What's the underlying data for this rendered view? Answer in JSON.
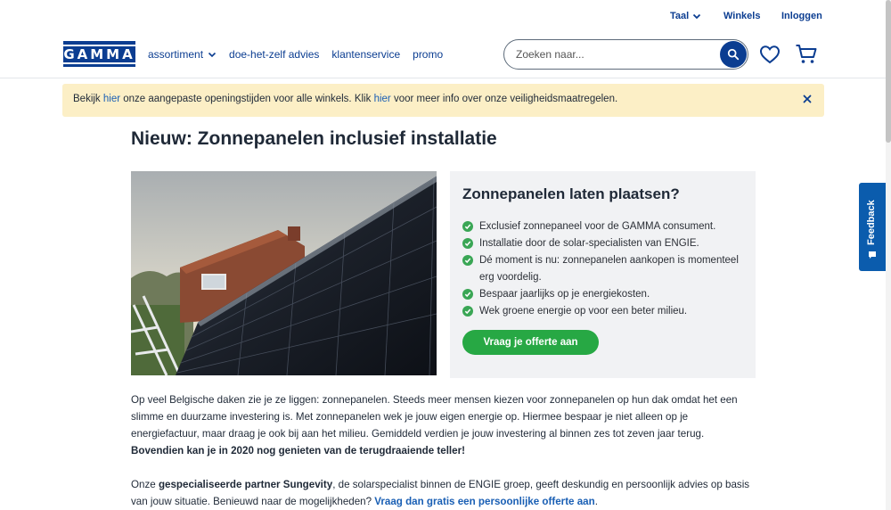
{
  "utility": {
    "language_label": "Taal",
    "stores_label": "Winkels",
    "login_label": "Inloggen"
  },
  "header": {
    "logo_text": "GAMMA",
    "nav": [
      {
        "label": "assortiment",
        "has_dropdown": true
      },
      {
        "label": "doe-het-zelf advies"
      },
      {
        "label": "klantenservice"
      },
      {
        "label": "promo"
      }
    ],
    "search": {
      "placeholder": "Zoeken naar..."
    },
    "icons": [
      "search-icon",
      "heart-icon",
      "cart-icon"
    ]
  },
  "banner": {
    "part1": "Bekijk ",
    "link1": "hier",
    "part2": " onze aangepaste openingstijden voor alle winkels. Klik ",
    "link2": "hier",
    "part3": " voor meer info over onze veiligheidsmaatregelen."
  },
  "page": {
    "title": "Nieuw: Zonnepanelen inclusief installatie"
  },
  "panel": {
    "title": "Zonnepanelen laten plaatsen?",
    "items": [
      "Exclusief zonnepaneel voor de GAMMA consument.",
      "Installatie door de solar-specialisten van ENGIE.",
      "Dé moment is nu: zonnepanelen aankopen is momenteel erg voordelig.",
      "Bespaar jaarlijks op je energiekosten.",
      "Wek groene energie op voor een beter milieu."
    ],
    "cta_label": "Vraag je offerte aan"
  },
  "body": {
    "p1": "Op veel Belgische daken zie je ze liggen: zonnepanelen. Steeds meer mensen kiezen voor zonnepanelen op hun dak omdat het een slimme en duurzame investering is. Met zonnepanelen wek je jouw eigen energie op. Hiermee bespaar je niet alleen op je energiefactuur, maar draag je ook bij aan het milieu. Gemiddeld verdien je jouw investering al binnen zes tot zeven jaar terug.",
    "p1_bold": "Bovendien kan je in 2020 nog genieten van de terugdraaiende teller!",
    "p2_start": "Onze ",
    "p2_bold": "gespecialiseerde partner Sungevity",
    "p2_mid": ", de solarspecialist binnen de ENGIE groep, geeft deskundig en persoonlijk advies op basis van jouw situatie. Benieuwd naar de mogelijkheden? ",
    "p2_link": "Vraag dan gratis een persoonlijke offerte aan",
    "p2_end": "."
  },
  "feedback": {
    "label": "Feedback"
  },
  "colors": {
    "brand_blue": "#0b3d91",
    "link_blue": "#1a5fb4",
    "banner_bg": "#fcefc6",
    "panel_bg": "#f1f2f4",
    "cta_green": "#27a844",
    "check_green": "#3aa655",
    "feedback_blue": "#0b5cad"
  }
}
